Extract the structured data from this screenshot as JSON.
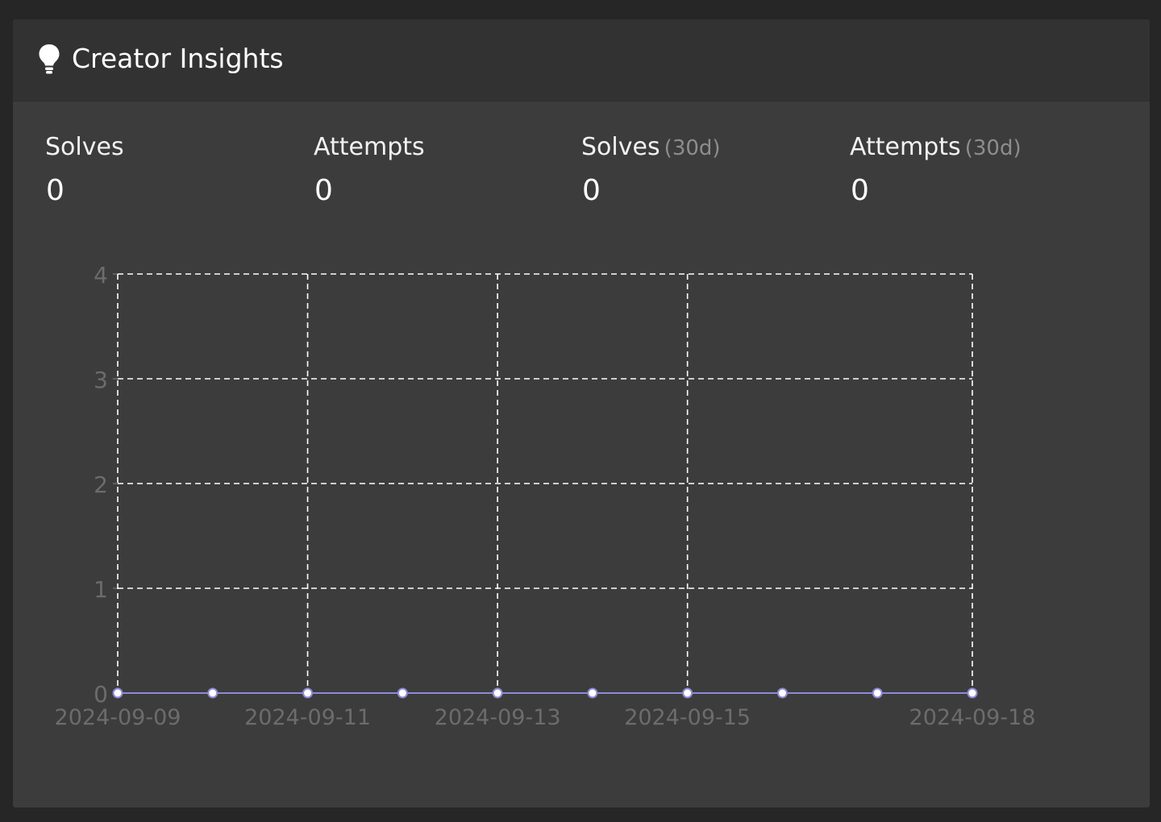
{
  "panel": {
    "title": "Creator Insights",
    "icon": "lightbulb-icon"
  },
  "stats": [
    {
      "label": "Solves",
      "suffix": "",
      "value": "0"
    },
    {
      "label": "Attempts",
      "suffix": "",
      "value": "0"
    },
    {
      "label": "Solves",
      "suffix": "(30d)",
      "value": "0"
    },
    {
      "label": "Attempts",
      "suffix": "(30d)",
      "value": "0"
    }
  ],
  "colors": {
    "line": "#8f8ad6",
    "grid": "#ffffff",
    "tick_text": "#6c6c6c"
  },
  "chart_data": {
    "type": "line",
    "x": [
      "2024-09-09",
      "2024-09-10",
      "2024-09-11",
      "2024-09-12",
      "2024-09-13",
      "2024-09-14",
      "2024-09-15",
      "2024-09-16",
      "2024-09-17",
      "2024-09-18"
    ],
    "series": [
      {
        "values": [
          0,
          0,
          0,
          0,
          0,
          0,
          0,
          0,
          0,
          0
        ]
      }
    ],
    "x_tick_labels": [
      "2024-09-09",
      "2024-09-11",
      "2024-09-13",
      "2024-09-15",
      "2024-09-18"
    ],
    "y_ticks": [
      0,
      1,
      2,
      3,
      4
    ],
    "ylim": [
      0,
      4
    ],
    "grid": true,
    "legend": "none"
  }
}
